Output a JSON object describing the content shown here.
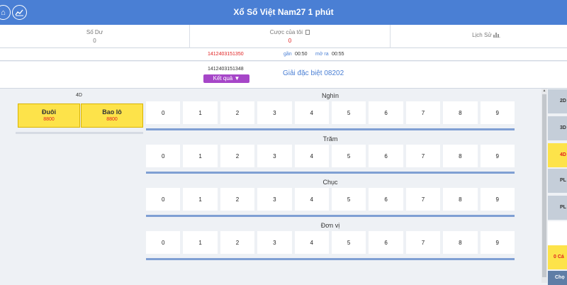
{
  "header": {
    "title": "Xổ Số Việt Nam27 1 phút",
    "home_icon": "home-icon",
    "stats_icon": "stats-icon"
  },
  "summary": {
    "balance_label": "Số Dư",
    "balance_value": "0",
    "bet_label": "Cược của tôi",
    "bet_value": "0",
    "history_label": "Lịch Sử"
  },
  "timer": {
    "current_period": "1412403151350",
    "close_label": "gần",
    "close_time": "00:50",
    "open_label": "mở ra",
    "open_time": "00:55"
  },
  "result": {
    "prev_period": "1412403151348",
    "result_button": "Kết quả ▼",
    "special_prize": "Giải đặc biệt 08202"
  },
  "left_panel": {
    "mode_label": "4D",
    "options": [
      {
        "name": "Đuôi",
        "odds": "8800"
      },
      {
        "name": "Bao lô",
        "odds": "8800"
      }
    ]
  },
  "digit_groups": [
    {
      "title": "Nghìn",
      "digits": [
        "0",
        "1",
        "2",
        "3",
        "4",
        "5",
        "6",
        "7",
        "8",
        "9"
      ]
    },
    {
      "title": "Trăm",
      "digits": [
        "0",
        "1",
        "2",
        "3",
        "4",
        "5",
        "6",
        "7",
        "8",
        "9"
      ]
    },
    {
      "title": "Chục",
      "digits": [
        "0",
        "1",
        "2",
        "3",
        "4",
        "5",
        "6",
        "7",
        "8",
        "9"
      ]
    },
    {
      "title": "Đơn vị",
      "digits": [
        "0",
        "1",
        "2",
        "3",
        "4",
        "5",
        "6",
        "7",
        "8",
        "9"
      ]
    }
  ],
  "side_tabs": [
    {
      "label": "2D",
      "style": "gray"
    },
    {
      "label": "3D",
      "style": "gray"
    },
    {
      "label": "4D",
      "style": "yellow"
    },
    {
      "label": "PL",
      "style": "gray"
    },
    {
      "label": "PL",
      "style": "gray"
    },
    {
      "label": "",
      "style": "white"
    },
    {
      "label": "0 Cá",
      "style": "yellow"
    },
    {
      "label": "Chọ",
      "style": "blue"
    }
  ],
  "colors": {
    "header": "#4a7fd4",
    "accent_yellow": "#fde34a",
    "odds_red": "#e02020",
    "result_purple": "#a646c8"
  }
}
